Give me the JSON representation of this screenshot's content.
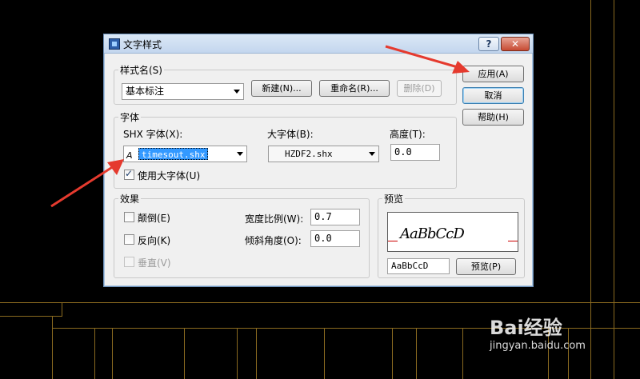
{
  "dialog": {
    "title": "文字样式",
    "help_btn": "?",
    "close_btn": "✕"
  },
  "style_group": {
    "label": "样式名(S)",
    "selected": "基本标注",
    "new_btn": "新建(N)...",
    "rename_btn": "重命名(R)...",
    "delete_btn": "删除(D)"
  },
  "side_buttons": {
    "apply": "应用(A)",
    "cancel": "取消",
    "help": "帮助(H)"
  },
  "font_group": {
    "label": "字体",
    "shx_label": "SHX 字体(X):",
    "shx_value": "timesout.shx",
    "bigfont_label": "大字体(B):",
    "bigfont_value": "HZDF2.shx",
    "height_label": "高度(T):",
    "height_value": "0.0",
    "use_bigfont_label": "使用大字体(U)",
    "use_bigfont_checked": true
  },
  "effects_group": {
    "label": "效果",
    "upside_down": "颠倒(E)",
    "backwards": "反向(K)",
    "vertical": "垂直(V)",
    "width_factor_label": "宽度比例(W):",
    "width_factor_value": "0.7",
    "oblique_label": "倾斜角度(O):",
    "oblique_value": "0.0"
  },
  "preview_group": {
    "label": "预览",
    "sample_render": "AaBbCcD",
    "input_value": "AaBbCcD",
    "preview_btn": "预览(P)"
  },
  "watermark": {
    "logo": "Bai经验",
    "url": "jingyan.baidu.com"
  },
  "colors": {
    "arrow": "#e53a2e",
    "cad_line": "#8a6a20",
    "selection": "#3399ff"
  }
}
